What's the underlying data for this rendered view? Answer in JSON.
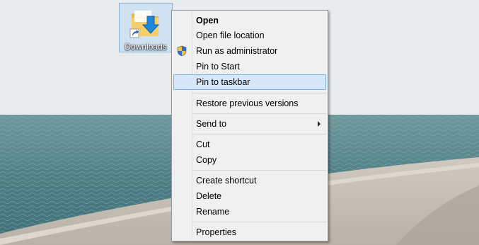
{
  "desktop": {
    "icon": {
      "label": "Downloads",
      "icon_name": "downloads-folder-shortcut-icon"
    }
  },
  "context_menu": {
    "items": [
      {
        "label": "Open",
        "bold": true
      },
      {
        "label": "Open file location"
      },
      {
        "label": "Run as administrator",
        "icon": "uac-shield-icon"
      },
      {
        "label": "Pin to Start"
      },
      {
        "label": "Pin to taskbar",
        "highlighted": true
      },
      {
        "label": "Restore previous versions"
      },
      {
        "label": "Send to",
        "submenu": true
      },
      {
        "label": "Cut"
      },
      {
        "label": "Copy"
      },
      {
        "label": "Create shortcut"
      },
      {
        "label": "Delete"
      },
      {
        "label": "Rename"
      },
      {
        "label": "Properties"
      }
    ],
    "highlight_color": "#d5e7f8",
    "highlight_border": "#7ab1e6"
  }
}
